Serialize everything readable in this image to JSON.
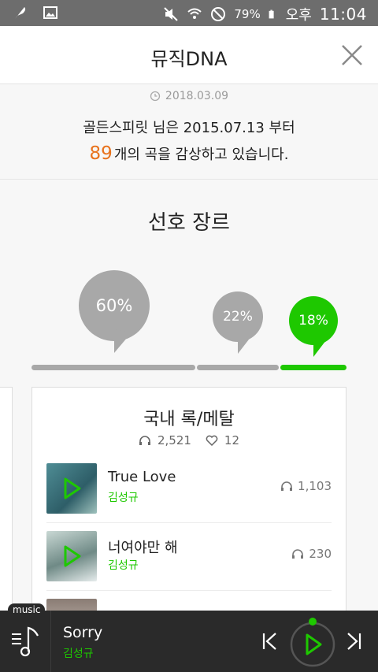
{
  "status": {
    "battery": "79%",
    "ampm": "오후",
    "time": "11:04"
  },
  "header": {
    "title": "뮤직DNA"
  },
  "summary": {
    "date": "2018.03.09",
    "line1": "골든스피릿 님은 2015.07.13 부터",
    "song_count": "89",
    "line2_suffix": "개의 곡을 감상하고 있습니다."
  },
  "genre": {
    "title": "선호 장르",
    "segments": [
      {
        "percent": 60,
        "label": "60%",
        "color": "#a8a8a8"
      },
      {
        "percent": 22,
        "label": "22%",
        "color": "#a8a8a8"
      },
      {
        "percent": 18,
        "label": "18%",
        "color": "#1ec800"
      }
    ]
  },
  "card": {
    "name": "국내 록/메탈",
    "listens": "2,521",
    "likes": "12",
    "songs": [
      {
        "title": "True Love",
        "artist": "김성규",
        "plays": "1,103"
      },
      {
        "title": "너여야만 해",
        "artist": "김성규",
        "plays": "230"
      },
      {
        "title": "...",
        "artist": "",
        "plays": ""
      }
    ]
  },
  "player": {
    "tag": "music",
    "title": "Sorry",
    "artist": "김성규"
  },
  "colors": {
    "accent_green": "#1ec800",
    "count_orange": "#e8721c",
    "player_bg": "#2a2a2a"
  }
}
